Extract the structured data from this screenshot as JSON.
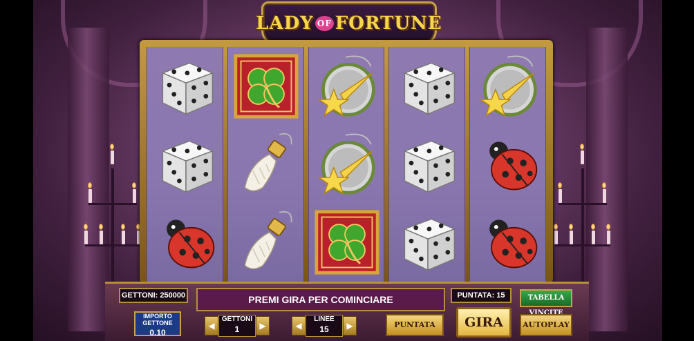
{
  "game": {
    "logo": {
      "left": "LADY",
      "middle": "OF",
      "right": "FORTUNE"
    }
  },
  "reels": [
    [
      "dice",
      "dice",
      "ladybug"
    ],
    [
      "clover",
      "rabbit-foot",
      "rabbit-foot"
    ],
    [
      "shooting-star-charm",
      "shooting-star-charm",
      "clover"
    ],
    [
      "dice",
      "dice",
      "dice"
    ],
    [
      "shooting-star-charm",
      "ladybug",
      "ladybug"
    ]
  ],
  "panel": {
    "gettoni_total": "GETTONI: 250000",
    "message": "PREMI GIRA PER COMINCIARE",
    "puntata": "PUNTATA: 15",
    "importo_label": "IMPORTO GETTONE",
    "importo_value": "0.10",
    "gettoni_label": "GETTONI",
    "gettoni_value": "1",
    "linee_label": "LINEE",
    "linee_value": "15",
    "puntata_max": "PUNTATA MAX",
    "gira": "GIRA",
    "tabella": "TABELLA VINCITE",
    "autoplay": "AUTOPLAY",
    "arrow_left": "◀",
    "arrow_right": "▶"
  },
  "colors": {
    "reel_bg": "#8e7ab0",
    "gold": "#c9a24a",
    "message_bg": "#5a1a4a",
    "importo_bg": "#1d3a86",
    "tabella_bg": "#2a8a3a"
  }
}
